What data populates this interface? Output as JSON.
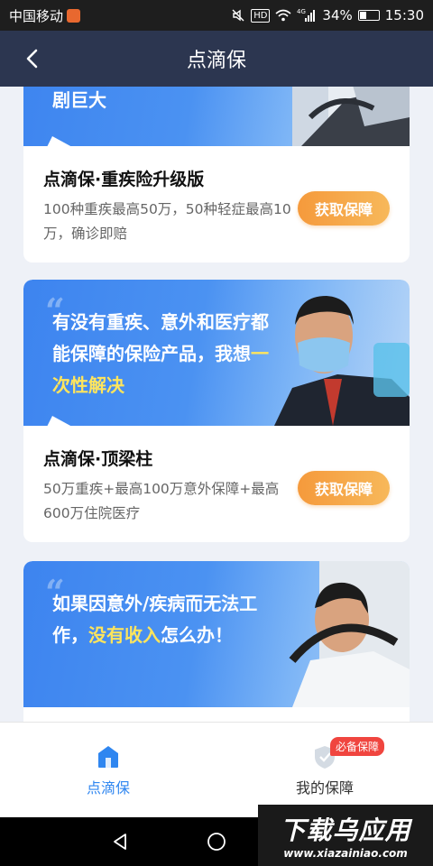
{
  "status_bar": {
    "carrier": "中国移动",
    "hd": "HD",
    "network": "4G",
    "battery_pct": "34%",
    "battery_level": 0.34,
    "time": "15:30"
  },
  "nav": {
    "title": "点滴保"
  },
  "cards": [
    {
      "banner_text": "剧巨大",
      "title": "点滴保·重疾险升级版",
      "desc": "100种重疾最高50万，50种轻症最高10万，确诊即赔",
      "button": "获取保障"
    },
    {
      "banner_quote": "“",
      "banner_text_a": "有没有重疾、意外和医疗都能保障的保险产品，我想",
      "banner_text_hl": "一次性解决",
      "title": "点滴保·顶梁柱",
      "desc": "50万重疾+最高100万意外保障+最高600万住院医疗",
      "button": "获取保障"
    },
    {
      "banner_quote": "“",
      "banner_text_a": "如果因意外/疾病而无法工作，",
      "banner_text_hl": "没有收入",
      "banner_text_b": "怎么办！"
    }
  ],
  "tabs": [
    {
      "label": "点滴保",
      "icon": "home-icon",
      "active": true
    },
    {
      "label": "我的保障",
      "icon": "shield-icon",
      "active": false,
      "badge": "必备保障"
    }
  ],
  "watermark": {
    "main": "下载乌应用",
    "sub": "www.xiazainiao.com"
  },
  "colors": {
    "accent": "#2f86f0",
    "button": "#f59a3c",
    "nav": "#2c3650",
    "highlight": "#ffe55c"
  }
}
